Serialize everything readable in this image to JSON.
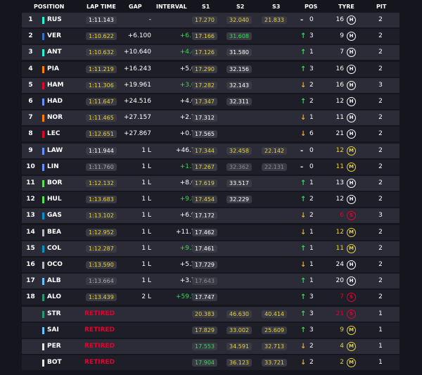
{
  "headers": {
    "position": "POSITION",
    "lap_time": "LAP TIME",
    "gap": "GAP",
    "interval": "INTERVAL",
    "s1": "S1",
    "s2": "S2",
    "s3": "S3",
    "pos": "POS",
    "tyre": "TYRE",
    "pit": "PIT"
  },
  "team_colors": {
    "mercedes": "#27f4d2",
    "redbull": "#3671c6",
    "mclaren": "#ff8000",
    "ferrari": "#e8002d",
    "rb": "#6692ff",
    "haas": "#b6babd",
    "alpine": "#0093cc",
    "aston": "#229971",
    "williams": "#64c4ff",
    "sauber": "#52e252"
  },
  "rows": [
    {
      "pos": "1",
      "code": "RUS",
      "team": "#27f4d2",
      "lap": "1:11.143",
      "lap_c": "white",
      "gap": "-",
      "interval": "-",
      "int_c": "white",
      "s1": "17.270",
      "s1_c": "yellow",
      "s2": "32.040",
      "s2_c": "yellow",
      "s3": "21.833",
      "s3_c": "yellow",
      "dir": "same",
      "arrow": "-",
      "change": "0",
      "tyre_laps": "16",
      "tl_c": "white",
      "tyre": "H",
      "pit": "2"
    },
    {
      "pos": "2",
      "code": "VER",
      "team": "#3671c6",
      "lap": "1:10.622",
      "lap_c": "yellow",
      "gap": "+6.100",
      "interval": "+6.100",
      "int_c": "green",
      "s1": "17.166",
      "s1_c": "yellow",
      "s2": "31.608",
      "s2_c": "green",
      "s3": "",
      "s3_c": "empty",
      "dir": "up",
      "arrow": "↑",
      "change": "3",
      "tyre_laps": "9",
      "tl_c": "white",
      "tyre": "H",
      "pit": "2"
    },
    {
      "pos": "3",
      "code": "ANT",
      "team": "#27f4d2",
      "lap": "1:10.632",
      "lap_c": "yellow",
      "gap": "+10.640",
      "interval": "+4.444",
      "int_c": "green",
      "s1": "17.126",
      "s1_c": "yellow",
      "s2": "31.580",
      "s2_c": "white",
      "s3": "",
      "s3_c": "empty",
      "dir": "up",
      "arrow": "↑",
      "change": "1",
      "tyre_laps": "7",
      "tl_c": "white",
      "tyre": "H",
      "pit": "2"
    },
    {
      "pos": "4",
      "code": "PIA",
      "team": "#ff8000",
      "lap": "1:11.219",
      "lap_c": "yellow",
      "gap": "+16.243",
      "interval": "+5.633",
      "int_c": "white",
      "s1": "17.290",
      "s1_c": "yellow",
      "s2": "32.156",
      "s2_c": "white",
      "s3": "",
      "s3_c": "empty",
      "dir": "up",
      "arrow": "↑",
      "change": "3",
      "tyre_laps": "16",
      "tl_c": "white",
      "tyre": "H",
      "pit": "2"
    },
    {
      "pos": "5",
      "code": "HAM",
      "team": "#e8002d",
      "lap": "1:11.306",
      "lap_c": "yellow",
      "gap": "+19.961",
      "interval": "+3.665",
      "int_c": "green",
      "s1": "17.282",
      "s1_c": "yellow",
      "s2": "32.143",
      "s2_c": "white",
      "s3": "",
      "s3_c": "empty",
      "dir": "down",
      "arrow": "↓",
      "change": "2",
      "tyre_laps": "16",
      "tl_c": "white",
      "tyre": "H",
      "pit": "3"
    },
    {
      "pos": "6",
      "code": "HAD",
      "team": "#6692ff",
      "lap": "1:11.647",
      "lap_c": "yellow",
      "gap": "+24.516",
      "interval": "+4.615",
      "int_c": "white",
      "s1": "17.347",
      "s1_c": "yellow",
      "s2": "32.311",
      "s2_c": "white",
      "s3": "",
      "s3_c": "empty",
      "dir": "up",
      "arrow": "↑",
      "change": "2",
      "tyre_laps": "12",
      "tl_c": "white",
      "tyre": "H",
      "pit": "2"
    },
    {
      "pos": "7",
      "code": "NOR",
      "team": "#ff8000",
      "lap": "1:11.465",
      "lap_c": "yellow",
      "gap": "+27.157",
      "interval": "+2.756",
      "int_c": "white",
      "s1": "17.312",
      "s1_c": "white",
      "s2": "",
      "s2_c": "empty",
      "s3": "",
      "s3_c": "empty",
      "dir": "down",
      "arrow": "↓",
      "change": "1",
      "tyre_laps": "11",
      "tl_c": "white",
      "tyre": "H",
      "pit": "2"
    },
    {
      "pos": "8",
      "code": "LEC",
      "team": "#e8002d",
      "lap": "1:12.651",
      "lap_c": "yellow",
      "gap": "+27.867",
      "interval": "+0.710",
      "int_c": "white",
      "s1": "17.565",
      "s1_c": "white",
      "s2": "",
      "s2_c": "empty",
      "s3": "",
      "s3_c": "empty",
      "dir": "down",
      "arrow": "↓",
      "change": "6",
      "tyre_laps": "21",
      "tl_c": "white",
      "tyre": "H",
      "pit": "2"
    },
    {
      "pos": "9",
      "code": "LAW",
      "team": "#6692ff",
      "lap": "1:11.944",
      "lap_c": "white",
      "gap": "1 L",
      "interval": "+46.141",
      "int_c": "white",
      "s1": "17.344",
      "s1_c": "yellow",
      "s2": "32.458",
      "s2_c": "yellow",
      "s3": "22.142",
      "s3_c": "yellow",
      "dir": "same",
      "arrow": "-",
      "change": "0",
      "tyre_laps": "12",
      "tl_c": "yellow",
      "tyre": "M",
      "pit": "2"
    },
    {
      "pos": "10",
      "code": "LIN",
      "team": "#6692ff",
      "lap": "1:11.760",
      "lap_c": "grey",
      "gap": "1 L",
      "interval": "+1.569",
      "int_c": "green",
      "s1": "17.267",
      "s1_c": "yellow",
      "s2": "32.362",
      "s2_c": "grey",
      "s3": "22.131",
      "s3_c": "grey",
      "dir": "same",
      "arrow": "-",
      "change": "0",
      "tyre_laps": "11",
      "tl_c": "yellow",
      "tyre": "M",
      "pit": "2"
    },
    {
      "pos": "11",
      "code": "BOR",
      "team": "#52e252",
      "lap": "1:12.132",
      "lap_c": "yellow",
      "gap": "1 L",
      "interval": "+8.610",
      "int_c": "white",
      "s1": "17.619",
      "s1_c": "yellow",
      "s2": "33.517",
      "s2_c": "white",
      "s3": "",
      "s3_c": "empty",
      "dir": "up",
      "arrow": "↑",
      "change": "1",
      "tyre_laps": "13",
      "tl_c": "white",
      "tyre": "H",
      "pit": "2"
    },
    {
      "pos": "12",
      "code": "HUL",
      "team": "#52e252",
      "lap": "1:13.683",
      "lap_c": "yellow",
      "gap": "1 L",
      "interval": "+9.802",
      "int_c": "green",
      "s1": "17.454",
      "s1_c": "yellow",
      "s2": "32.229",
      "s2_c": "white",
      "s3": "",
      "s3_c": "empty",
      "dir": "up",
      "arrow": "↑",
      "change": "2",
      "tyre_laps": "12",
      "tl_c": "white",
      "tyre": "H",
      "pit": "2"
    },
    {
      "pos": "13",
      "code": "GAS",
      "team": "#0093cc",
      "lap": "1:13.102",
      "lap_c": "yellow",
      "gap": "1 L",
      "interval": "+6.910",
      "int_c": "white",
      "s1": "17.172",
      "s1_c": "white",
      "s2": "",
      "s2_c": "empty",
      "s3": "",
      "s3_c": "empty",
      "dir": "down",
      "arrow": "↓",
      "change": "2",
      "tyre_laps": "6",
      "tl_c": "red",
      "tyre": "S",
      "pit": "3"
    },
    {
      "pos": "14",
      "code": "BEA",
      "team": "#b6babd",
      "lap": "1:12.952",
      "lap_c": "yellow",
      "gap": "1 L",
      "interval": "+11.734",
      "int_c": "white",
      "s1": "17.462",
      "s1_c": "white",
      "s2": "",
      "s2_c": "empty",
      "s3": "",
      "s3_c": "empty",
      "dir": "down",
      "arrow": "↓",
      "change": "1",
      "tyre_laps": "12",
      "tl_c": "yellow",
      "tyre": "M",
      "pit": "2"
    },
    {
      "pos": "15",
      "code": "COL",
      "team": "#0093cc",
      "lap": "1:12.287",
      "lap_c": "yellow",
      "gap": "1 L",
      "interval": "+9.273",
      "int_c": "green",
      "s1": "17.461",
      "s1_c": "white",
      "s2": "",
      "s2_c": "empty",
      "s3": "",
      "s3_c": "empty",
      "dir": "up",
      "arrow": "↑",
      "change": "1",
      "tyre_laps": "11",
      "tl_c": "yellow",
      "tyre": "M",
      "pit": "2"
    },
    {
      "pos": "16",
      "code": "OCO",
      "team": "#b6babd",
      "lap": "1:13.590",
      "lap_c": "yellow",
      "gap": "1 L",
      "interval": "+5.205",
      "int_c": "white",
      "s1": "17.729",
      "s1_c": "white",
      "s2": "",
      "s2_c": "empty",
      "s3": "",
      "s3_c": "empty",
      "dir": "down",
      "arrow": "↓",
      "change": "1",
      "tyre_laps": "24",
      "tl_c": "white",
      "tyre": "H",
      "pit": "2"
    },
    {
      "pos": "17",
      "code": "ALB",
      "team": "#64c4ff",
      "lap": "1:13.664",
      "lap_c": "grey",
      "gap": "1 L",
      "interval": "+3.705",
      "int_c": "white",
      "s1": "17.643",
      "s1_c": "grey",
      "s2": "",
      "s2_c": "empty",
      "s3": "",
      "s3_c": "empty",
      "dir": "up",
      "arrow": "↑",
      "change": "1",
      "tyre_laps": "20",
      "tl_c": "white",
      "tyre": "H",
      "pit": "2"
    },
    {
      "pos": "18",
      "code": "ALO",
      "team": "#229971",
      "lap": "1:13.439",
      "lap_c": "yellow",
      "gap": "2 L",
      "interval": "+59.510",
      "int_c": "green",
      "s1": "17.747",
      "s1_c": "white",
      "s2": "",
      "s2_c": "empty",
      "s3": "",
      "s3_c": "empty",
      "dir": "up",
      "arrow": "↑",
      "change": "3",
      "tyre_laps": "7",
      "tl_c": "red",
      "tyre": "S",
      "pit": "2"
    },
    {
      "pos": "",
      "code": "STR",
      "team": "#229971",
      "retired": "RETIRED",
      "lap": "",
      "gap": "",
      "interval": "",
      "int_c": "white",
      "s1": "20.383",
      "s1_c": "yellow",
      "s2": "46.630",
      "s2_c": "yellow",
      "s3": "40.414",
      "s3_c": "yellow",
      "dir": "up",
      "arrow": "↑",
      "change": "3",
      "tyre_laps": "21",
      "tl_c": "red",
      "tyre": "S",
      "pit": "1"
    },
    {
      "pos": "",
      "code": "SAI",
      "team": "#64c4ff",
      "retired": "RETIRED",
      "lap": "",
      "gap": "",
      "interval": "",
      "int_c": "white",
      "s1": "17.829",
      "s1_c": "yellow",
      "s2": "33.002",
      "s2_c": "yellow",
      "s3": "25.609",
      "s3_c": "yellow",
      "dir": "up",
      "arrow": "↑",
      "change": "3",
      "tyre_laps": "9",
      "tl_c": "yellow",
      "tyre": "M",
      "pit": "1"
    },
    {
      "pos": "",
      "code": "PER",
      "team": "#e8e8e8",
      "retired": "RETIRED",
      "lap": "",
      "gap": "",
      "interval": "",
      "int_c": "white",
      "s1": "17.553",
      "s1_c": "green",
      "s2": "34.591",
      "s2_c": "yellow",
      "s3": "32.713",
      "s3_c": "yellow",
      "dir": "down",
      "arrow": "↓",
      "change": "2",
      "tyre_laps": "4",
      "tl_c": "yellow",
      "tyre": "M",
      "pit": "1"
    },
    {
      "pos": "",
      "code": "BOT",
      "team": "#e8e8e8",
      "retired": "RETIRED",
      "lap": "",
      "gap": "",
      "interval": "",
      "int_c": "white",
      "s1": "17.904",
      "s1_c": "green",
      "s2": "36.123",
      "s2_c": "yellow",
      "s3": "33.721",
      "s3_c": "yellow",
      "dir": "down",
      "arrow": "↓",
      "change": "2",
      "tyre_laps": "2",
      "tl_c": "yellow",
      "tyre": "M",
      "pit": "1"
    }
  ]
}
